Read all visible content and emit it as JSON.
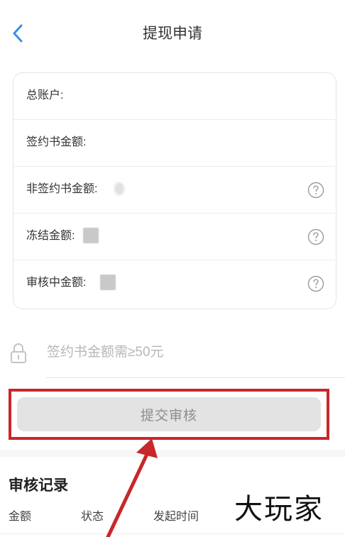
{
  "header": {
    "title": "提现申请",
    "back_icon": "chevron-left-icon"
  },
  "account": {
    "rows": [
      {
        "label": "总账户:",
        "value": "",
        "help": false
      },
      {
        "label": "签约书金额:",
        "value": "",
        "help": false
      },
      {
        "label": "非签约书金额:",
        "value": "",
        "help": true
      },
      {
        "label": "冻结金额:",
        "value": "",
        "help": true
      },
      {
        "label": "审核中金额:",
        "value": "",
        "help": true
      }
    ]
  },
  "withdraw": {
    "placeholder": "签约书金额需≥50元",
    "submit_label": "提交审核"
  },
  "records": {
    "title": "审核记录",
    "columns": [
      "金额",
      "状态",
      "发起时间"
    ]
  },
  "watermark": "大玩家",
  "colors": {
    "accent_blue": "#3a8ee6",
    "highlight_red": "#c8272b",
    "button_gray": "#e3e3e3"
  }
}
